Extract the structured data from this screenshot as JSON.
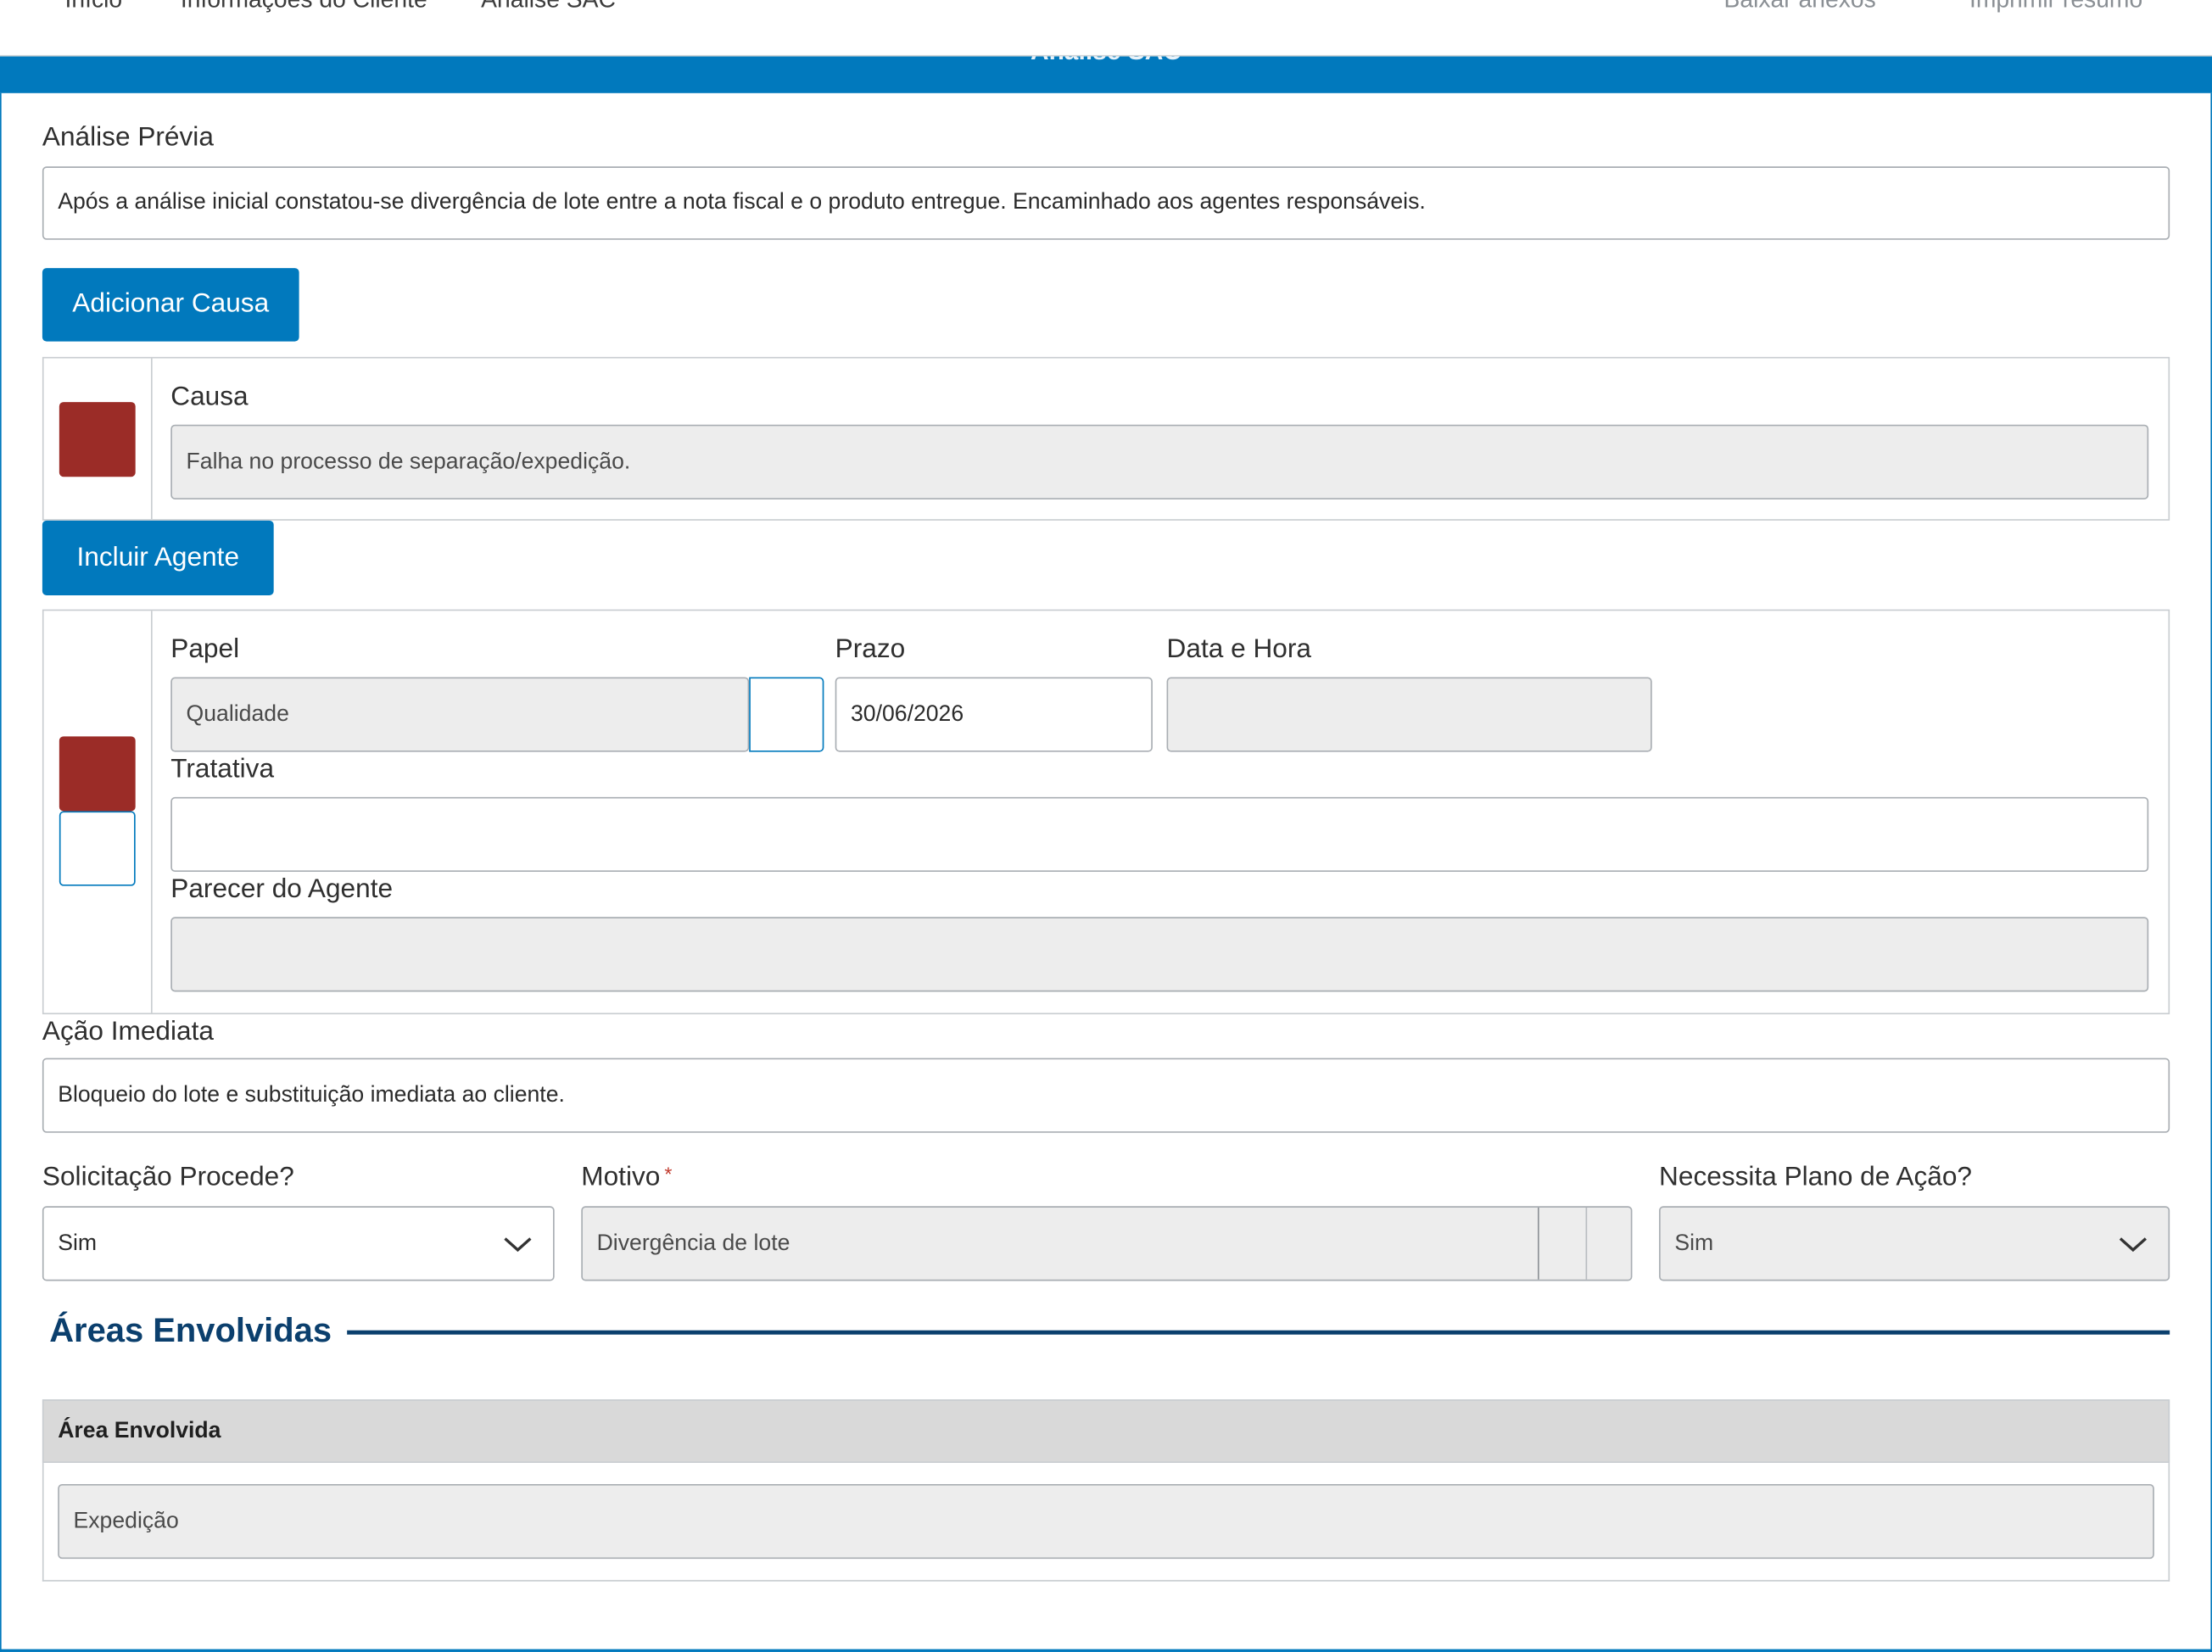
{
  "nav": {
    "left": [
      "Início",
      "Informações do Cliente",
      "Análise SAC"
    ],
    "right": [
      "Baixar anexos",
      "Imprimir resumo"
    ]
  },
  "banner": {
    "title": "Análise SAC"
  },
  "analise_previa": {
    "label": "Análise Prévia",
    "value": "Após a análise inicial constatou-se divergência de lote entre a nota fiscal e o produto entregue. Encaminhado aos agentes responsáveis."
  },
  "causa": {
    "add_button": "Adicionar Causa",
    "label": "Causa",
    "value": "Falha no processo de separação/expedição."
  },
  "agente": {
    "add_button": "Incluir Agente",
    "papel_label": "Papel",
    "papel_value": "Qualidade",
    "prazo_label": "Prazo",
    "prazo_value": "30/06/2026",
    "data_hora_label": "Data e Hora",
    "data_hora_value": "",
    "tratativa_label": "Tratativa",
    "tratativa_value": "",
    "parecer_label": "Parecer do Agente",
    "parecer_value": ""
  },
  "acao_imediata": {
    "label": "Ação Imediata",
    "value": "Bloqueio do lote e substituição imediata ao cliente."
  },
  "solicitacao": {
    "label": "Solicitação Procede?",
    "value": "Sim"
  },
  "motivo": {
    "label": "Motivo",
    "required_mark": "*",
    "value": "Divergência de lote"
  },
  "plano_acao": {
    "label": "Necessita Plano de Ação?",
    "value": "Sim"
  },
  "areas": {
    "title": "Áreas Envolvidas",
    "column_header": "Área Envolvida",
    "rows": [
      "Expedição"
    ]
  },
  "colors": {
    "primary": "#0179bd",
    "danger": "#9b2c27",
    "section_title": "#0b3f6d",
    "readonly_bg": "#ededed"
  },
  "icons": [
    "chevron-down-icon"
  ]
}
